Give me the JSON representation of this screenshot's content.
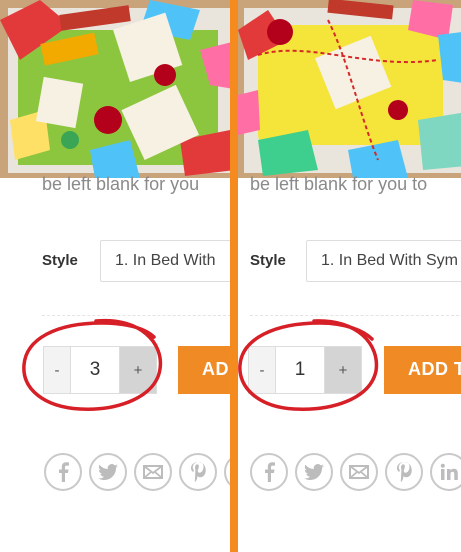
{
  "panels": [
    {
      "id": "left",
      "description_text": "be left blank for you",
      "style_label": "Style",
      "style_value": "1. In Bed With",
      "quantity": {
        "minus": "-",
        "value": "3",
        "plus": "+"
      },
      "add_button": "ADD"
    },
    {
      "id": "right",
      "description_text": "be left blank for you to",
      "style_label": "Style",
      "style_value": "1. In Bed With Sym",
      "quantity": {
        "minus": "-",
        "value": "1",
        "plus": "+"
      },
      "add_button": "ADD T"
    }
  ],
  "share_icons": [
    "facebook-icon",
    "twitter-icon",
    "email-icon",
    "pinterest-icon",
    "linkedin-icon"
  ],
  "colors": {
    "accent": "#f08a24",
    "divider": "#f58a1f",
    "annotation": "#d61f26",
    "text_muted": "#8a8a8a"
  }
}
